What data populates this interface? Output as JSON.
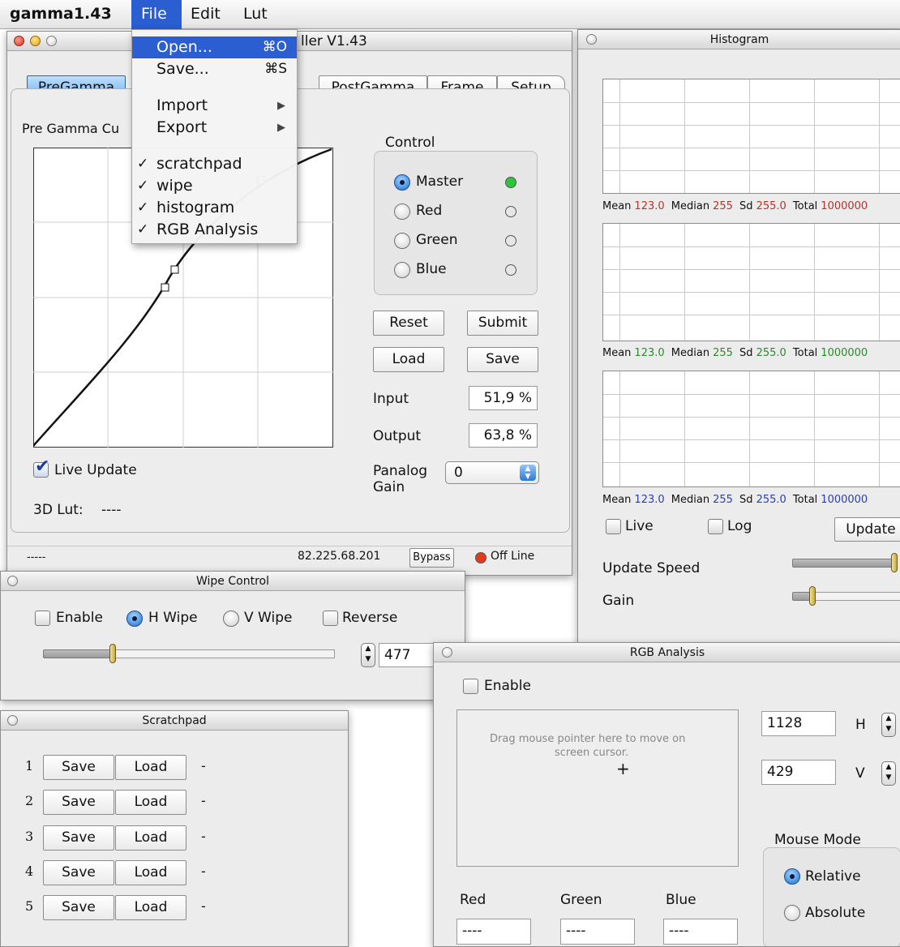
{
  "menubar": {
    "app_name": "gamma1.43",
    "items": [
      "File",
      "Edit",
      "Lut"
    ]
  },
  "file_menu": {
    "items": [
      {
        "label": "Open...",
        "shortcut": "⌘O"
      },
      {
        "label": "Save...",
        "shortcut": "⌘S"
      },
      {
        "label": "Import"
      },
      {
        "label": "Export"
      },
      {
        "label": "scratchpad",
        "checked": true
      },
      {
        "label": "wipe",
        "checked": true
      },
      {
        "label": "histogram",
        "checked": true
      },
      {
        "label": "RGB Analysis",
        "checked": true
      }
    ]
  },
  "main_window": {
    "title_fragment": "ller V1.43",
    "tabs": [
      "PreGamma",
      "PostGamma",
      "Frame",
      "Setup"
    ],
    "curve_label": "Pre Gamma Cu",
    "control": {
      "group_label": "Control",
      "channels": [
        {
          "label": "Master",
          "selected": true,
          "led": "#2fc53a"
        },
        {
          "label": "Red",
          "selected": false,
          "led": "#e6e6e6"
        },
        {
          "label": "Green",
          "selected": false,
          "led": "#e6e6e6"
        },
        {
          "label": "Blue",
          "selected": false,
          "led": "#e6e6e6"
        }
      ]
    },
    "buttons": {
      "reset": "Reset",
      "submit": "Submit",
      "load": "Load",
      "save": "Save"
    },
    "input_label": "Input",
    "input_value": "51,9 %",
    "output_label": "Output",
    "output_value": "63,8 %",
    "panalog_label_1": "Panalog",
    "panalog_label_2": "Gain",
    "panalog_value": "0",
    "live_update_label": "Live Update",
    "lut_label": "3D Lut:",
    "lut_value": "----",
    "status": {
      "left": "-----",
      "ip": "82.225.68.201",
      "bypass": "Bypass",
      "state": "Off Line",
      "state_color": "#e23b1c"
    }
  },
  "histogram": {
    "title": "Histogram",
    "stats": [
      {
        "mean_label": "Mean",
        "mean": "123.0",
        "median_label": "Median",
        "median": "255",
        "sd_label": "Sd",
        "sd": "255.0",
        "total_label": "Total",
        "total": "1000000",
        "color": "#b8312a"
      },
      {
        "mean_label": "Mean",
        "mean": "123.0",
        "median_label": "Median",
        "median": "255",
        "sd_label": "Sd",
        "sd": "255.0",
        "total_label": "Total",
        "total": "1000000",
        "color": "#2a8a2a"
      },
      {
        "mean_label": "Mean",
        "mean": "123.0",
        "median_label": "Median",
        "median": "255",
        "sd_label": "Sd",
        "sd": "255.0",
        "total_label": "Total",
        "total": "1000000",
        "color": "#2a3db8"
      }
    ],
    "live_label": "Live",
    "log_label": "Log",
    "update_button": "Update",
    "update_speed_label": "Update Speed",
    "update_speed_level": 0.97,
    "gain_label": "Gain",
    "gain_level": 0.2
  },
  "wipe": {
    "title": "Wipe Control",
    "enable_label": "Enable",
    "h_wipe_label": "H Wipe",
    "v_wipe_label": "V Wipe",
    "reverse_label": "Reverse",
    "slider_level": 0.23,
    "value": "477"
  },
  "scratchpad": {
    "title": "Scratchpad",
    "rows": [
      {
        "num": "1",
        "save": "Save",
        "load": "Load",
        "note": "-"
      },
      {
        "num": "2",
        "save": "Save",
        "load": "Load",
        "note": "-"
      },
      {
        "num": "3",
        "save": "Save",
        "load": "Load",
        "note": "-"
      },
      {
        "num": "4",
        "save": "Save",
        "load": "Load",
        "note": "-"
      },
      {
        "num": "5",
        "save": "Save",
        "load": "Load",
        "note": "-"
      }
    ]
  },
  "rgb": {
    "title": "RGB Analysis",
    "enable_label": "Enable",
    "drag_text_1": "Drag mouse pointer here to move on",
    "drag_text_2": "screen cursor.",
    "crosshair": "+",
    "h_value": "1128",
    "h_label": "H",
    "v_value": "429",
    "v_label": "V",
    "mouse_mode_label": "Mouse Mode",
    "relative_label": "Relative",
    "absolute_label": "Absolute",
    "red_label": "Red",
    "green_label": "Green",
    "blue_label": "Blue",
    "red_value": "----",
    "green_value": "----",
    "blue_value": "----"
  }
}
